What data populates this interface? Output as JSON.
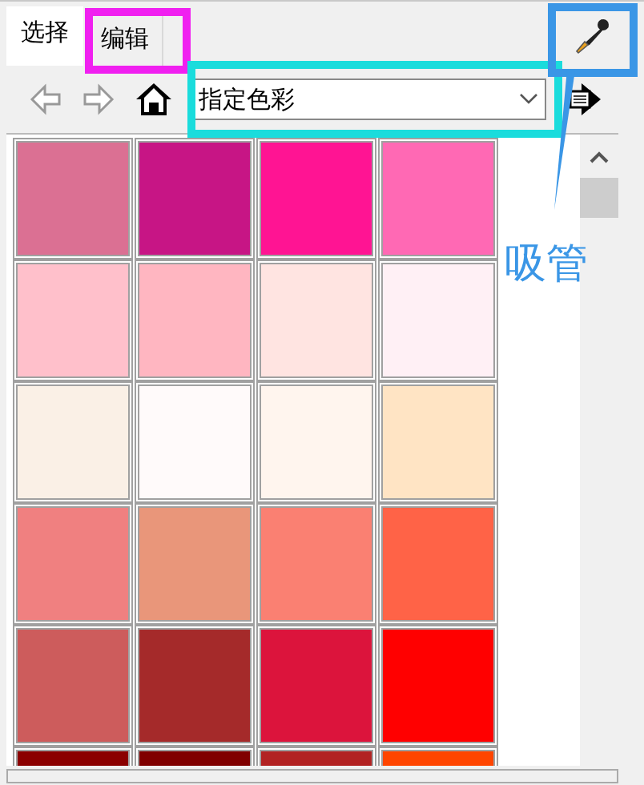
{
  "tabs": [
    {
      "label": "选择",
      "selected": true
    },
    {
      "label": "编辑",
      "selected": false
    }
  ],
  "toolbar": {
    "dropdown": {
      "value": "指定色彩"
    }
  },
  "swatches": [
    {
      "color": "#db7093"
    },
    {
      "color": "#c71585"
    },
    {
      "color": "#ff1493"
    },
    {
      "color": "#ff69b4"
    },
    {
      "color": "#ffc0cb"
    },
    {
      "color": "#ffb6c1"
    },
    {
      "color": "#ffe4e1"
    },
    {
      "color": "#fff0f5"
    },
    {
      "color": "#faf0e6"
    },
    {
      "color": "#fffafa"
    },
    {
      "color": "#fff5ee"
    },
    {
      "color": "#ffe4c4"
    },
    {
      "color": "#f08080"
    },
    {
      "color": "#e9967a"
    },
    {
      "color": "#fa8072"
    },
    {
      "color": "#ff6347"
    },
    {
      "color": "#cd5c5c"
    },
    {
      "color": "#a52a2a"
    },
    {
      "color": "#dc143c"
    },
    {
      "color": "#ff0000"
    },
    {
      "color": "#8b0000"
    },
    {
      "color": "#800000"
    },
    {
      "color": "#b22222"
    },
    {
      "color": "#ff4500"
    }
  ],
  "highlights": [
    {
      "kind": "tab",
      "color": "#f020f0"
    },
    {
      "kind": "dropdown",
      "color": "#1adcdc"
    },
    {
      "kind": "eyedropper",
      "color": "#3a96e6"
    }
  ],
  "callout": {
    "label": "吸管"
  }
}
